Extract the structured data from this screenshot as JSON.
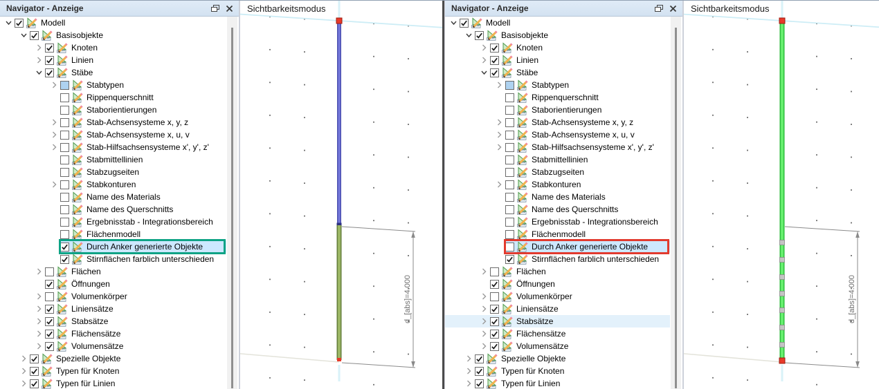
{
  "panels": {
    "left": {
      "title": "Navigator - Anzeige"
    },
    "right": {
      "title": "Navigator - Anzeige"
    }
  },
  "viewport": {
    "left": {
      "title": "Sichtbarkeitsmodus",
      "dimension_label": "d_[abs]=4.000"
    },
    "right": {
      "title": "Sichtbarkeitsmodus",
      "dimension_label": "d_[abs]=4.000"
    }
  },
  "icons": {
    "float_window": "float-window-icon",
    "close": "close-icon",
    "display_settings": "display-settings-icon",
    "expand_arrow": "expand-arrow-icon",
    "collapse_arrow": "collapse-arrow-icon"
  },
  "colors": {
    "titlebar_bg": "#d9e6f4",
    "selection_fill": "#cde8ff",
    "hover_fill": "#e3f1fb",
    "annotation_teal": "#0ea385",
    "annotation_red": "#e23a2e",
    "checkbox_partial_fill": "#aed2f0",
    "member_blue": "#7579dc",
    "member_blue_edge": "#4c50b0",
    "member_olive": "#9cb765",
    "member_olive_edge": "#637c3a",
    "member_green": "#66ef6e",
    "member_green_edge": "#2bbc3a",
    "node_red": "#e83a2a",
    "node_gray": "#c4c4c4",
    "grid_cyan": "#cdedf6",
    "grid_cyan_light": "#d9f2f8",
    "dimension_gray": "#8a8a8a",
    "dot_gray": "#636363"
  },
  "tree": {
    "rows": [
      {
        "label": "Modell",
        "level": 0,
        "expander": "expanded",
        "checkbox": "checked"
      },
      {
        "label": "Basisobjekte",
        "level": 1,
        "expander": "expanded",
        "checkbox": "checked"
      },
      {
        "label": "Knoten",
        "level": 2,
        "expander": "collapsed",
        "checkbox": "checked"
      },
      {
        "label": "Linien",
        "level": 2,
        "expander": "collapsed",
        "checkbox": "checked"
      },
      {
        "label": "Stäbe",
        "level": 2,
        "expander": "expanded",
        "checkbox": "checked"
      },
      {
        "label": "Stabtypen",
        "level": 3,
        "expander": "collapsed",
        "checkbox": "partial"
      },
      {
        "label": "Rippenquerschnitt",
        "level": 3,
        "expander": "none",
        "checkbox": "unchecked"
      },
      {
        "label": "Staborientierungen",
        "level": 3,
        "expander": "none",
        "checkbox": "unchecked"
      },
      {
        "label": "Stab-Achsensysteme x, y, z",
        "level": 3,
        "expander": "collapsed",
        "checkbox": "unchecked"
      },
      {
        "label": "Stab-Achsensysteme x, u, v",
        "level": 3,
        "expander": "collapsed",
        "checkbox": "unchecked"
      },
      {
        "label": "Stab-Hilfsachsensysteme x', y', z'",
        "level": 3,
        "expander": "collapsed",
        "checkbox": "unchecked"
      },
      {
        "label": "Stabmittellinien",
        "level": 3,
        "expander": "none",
        "checkbox": "unchecked"
      },
      {
        "label": "Stabzugseiten",
        "level": 3,
        "expander": "none",
        "checkbox": "unchecked"
      },
      {
        "label": "Stabkonturen",
        "level": 3,
        "expander": "collapsed",
        "checkbox": "unchecked"
      },
      {
        "label": "Name des Materials",
        "level": 3,
        "expander": "none",
        "checkbox": "unchecked"
      },
      {
        "label": "Name des Querschnitts",
        "level": 3,
        "expander": "none",
        "checkbox": "unchecked"
      },
      {
        "label": "Ergebnisstab - Integrationsbereich",
        "level": 3,
        "expander": "none",
        "checkbox": "unchecked"
      },
      {
        "label": "Flächenmodell",
        "level": 3,
        "expander": "none",
        "checkbox": "unchecked"
      },
      {
        "label": "Durch Anker generierte Objekte",
        "level": 3,
        "expander": "none",
        "checkbox": "checked",
        "left": {
          "checkbox": "checked",
          "selected": true,
          "annotation": "teal"
        },
        "right": {
          "checkbox": "unchecked",
          "selected": true,
          "annotation": "red"
        }
      },
      {
        "label": "Stirnflächen farblich unterschieden",
        "level": 3,
        "expander": "none",
        "checkbox": "checked"
      },
      {
        "label": "Flächen",
        "level": 2,
        "expander": "collapsed",
        "checkbox": "unchecked"
      },
      {
        "label": "Öffnungen",
        "level": 2,
        "expander": "none",
        "checkbox": "checked"
      },
      {
        "label": "Volumenkörper",
        "level": 2,
        "expander": "collapsed",
        "checkbox": "unchecked"
      },
      {
        "label": "Liniensätze",
        "level": 2,
        "expander": "collapsed",
        "checkbox": "checked"
      },
      {
        "label": "Stabsätze",
        "level": 2,
        "expander": "collapsed",
        "checkbox": "checked",
        "right": {
          "hover": true
        }
      },
      {
        "label": "Flächensätze",
        "level": 2,
        "expander": "collapsed",
        "checkbox": "checked"
      },
      {
        "label": "Volumensätze",
        "level": 2,
        "expander": "collapsed",
        "checkbox": "checked"
      },
      {
        "label": "Spezielle Objekte",
        "level": 1,
        "expander": "collapsed",
        "checkbox": "checked"
      },
      {
        "label": "Typen für Knoten",
        "level": 1,
        "expander": "collapsed",
        "checkbox": "checked"
      },
      {
        "label": "Typen für Linien",
        "level": 1,
        "expander": "collapsed",
        "checkbox": "checked"
      }
    ]
  }
}
